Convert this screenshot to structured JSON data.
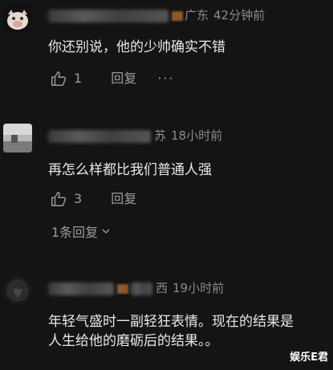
{
  "comments": [
    {
      "location": "广东",
      "time": "42分钟前",
      "text": "你还别说，他的少帅确实不错",
      "likes": "1",
      "reply_label": "回复",
      "more_label": "···"
    },
    {
      "location": "苏",
      "time": "18小时前",
      "text": "再怎么样都比我们普通人强",
      "likes": "3",
      "reply_label": "回复",
      "replies_label": "1条回复"
    },
    {
      "location": "西",
      "time": "19小时前",
      "text_line1": "年轻气盛时一副轻狂表情。现在的结果是",
      "text_line2": "人生给他的磨砺后的结果。。"
    }
  ],
  "watermark": "娱乐E君",
  "icons": {
    "like": "thumbs-up-icon",
    "expand": "chevron-down-icon",
    "more": "more-dots-icon"
  }
}
